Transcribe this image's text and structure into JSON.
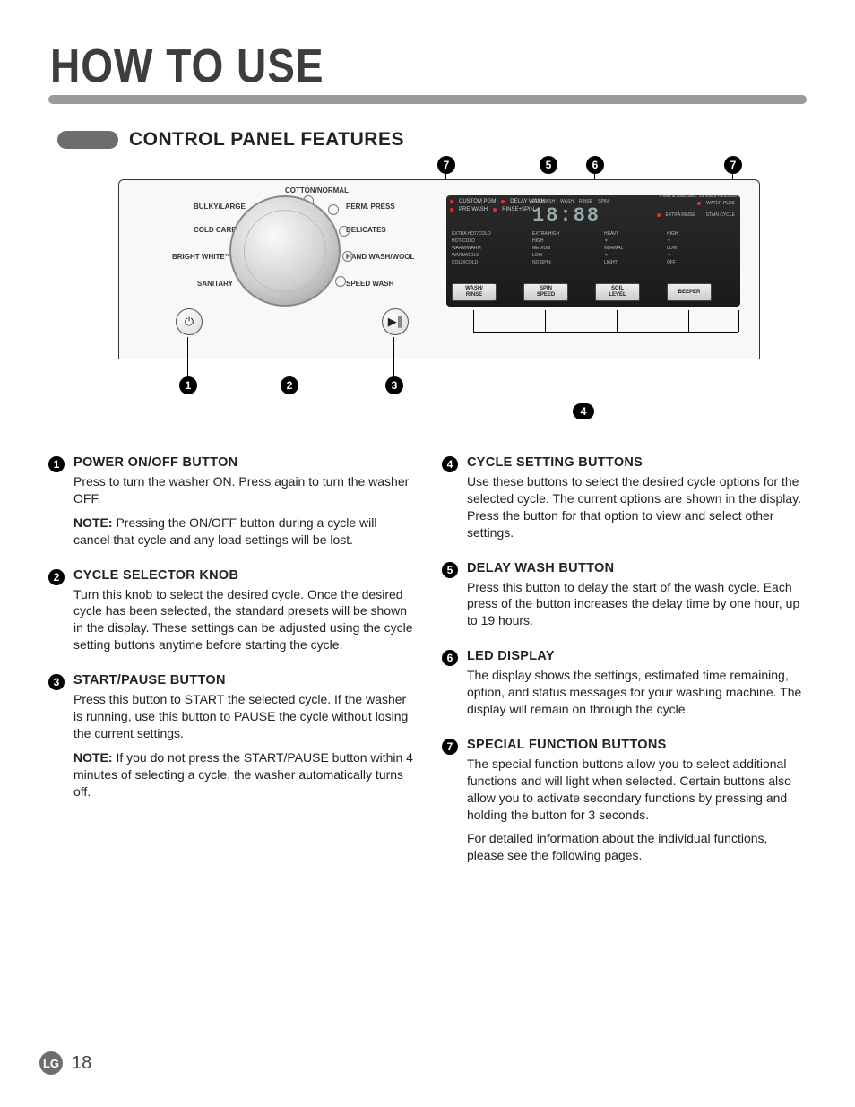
{
  "page": {
    "title": "HOW TO USE",
    "section_title": "CONTROL PANEL FEATURES",
    "page_number": "18",
    "logo_text": "LG"
  },
  "panel": {
    "cycles_left": [
      "BULKY/LARGE",
      "COLD CARE™",
      "BRIGHT WHITE™",
      "SANITARY"
    ],
    "cycle_top": "COTTON/NORMAL",
    "cycles_right": [
      "PERM. PRESS",
      "DELICATES",
      "HAND WASH/WOOL",
      "SPEED WASH"
    ],
    "top_options_left": [
      "CUSTOM PGM",
      "PRE-WASH",
      "EXTRA HOT/COLD",
      "HOT/COLD",
      "WARM/WARM",
      "WARM/COLD",
      "COLD/COLD"
    ],
    "top_options_mid": [
      "DELAY WASH",
      "RINSE+SPIN"
    ],
    "top_options_right": [
      "WATER PLUS",
      "EXTRA RINSE",
      "STAIN CYCLE"
    ],
    "digits": "18:88",
    "col_spin": [
      "EXTRA HIGH",
      "HIGH",
      "MEDIUM",
      "LOW",
      "NO SPIN"
    ],
    "col_soil": [
      "HEAVY",
      "NORMAL",
      "LIGHT"
    ],
    "col_beep": [
      "HIGH",
      "LOW",
      "OFF"
    ],
    "option_buttons": [
      "WASH/\nRINSE",
      "SPIN\nSPEED",
      "SOIL\nLEVEL",
      "BEEPER"
    ],
    "hold_note": "Press & Hold 3sec. for Extra Functions",
    "status_labels": [
      "PREWASH",
      "WASH",
      "RINSE",
      "SPIN"
    ]
  },
  "callouts": {
    "c1": "1",
    "c2": "2",
    "c3": "3",
    "c4": "4",
    "c5": "5",
    "c6": "6",
    "c7": "7"
  },
  "items": [
    {
      "num": "1",
      "title": "POWER ON/OFF BUTTON",
      "paras": [
        "Press to turn the washer ON. Press again to turn the washer OFF.",
        "<b>NOTE:</b> Pressing the ON/OFF button during a cycle will cancel that cycle and any load settings will be lost."
      ]
    },
    {
      "num": "2",
      "title": "CYCLE SELECTOR KNOB",
      "paras": [
        "Turn this knob to select the desired cycle. Once the desired cycle has been selected, the standard presets will be shown in the display. These settings can be adjusted using the cycle setting buttons anytime before starting the cycle."
      ]
    },
    {
      "num": "3",
      "title": "START/PAUSE BUTTON",
      "paras": [
        "Press this button to START the selected cycle. If the washer is running, use this button to PAUSE the cycle without losing the current settings.",
        "<b>NOTE:</b> If you do not press the START/PAUSE button within 4 minutes of selecting a cycle, the washer automatically turns off."
      ]
    },
    {
      "num": "4",
      "title": "CYCLE SETTING BUTTONS",
      "paras": [
        "Use these buttons to select the desired cycle options for the selected cycle. The current options are shown in the display. Press the button for that option to view and select other settings."
      ]
    },
    {
      "num": "5",
      "title": "DELAY WASH BUTTON",
      "paras": [
        "Press this button to delay the start of the wash cycle. Each press of the button increases the delay time by one hour, up to 19 hours."
      ]
    },
    {
      "num": "6",
      "title": "LED DISPLAY",
      "paras": [
        "The display shows the settings, estimated time remaining, option, and status messages for your washing machine. The display will remain on through the cycle."
      ]
    },
    {
      "num": "7",
      "title": "SPECIAL FUNCTION BUTTONS",
      "paras": [
        "The special function buttons allow you to select additional functions and will light when selected. Certain buttons also allow you to activate secondary functions by pressing and holding the button for 3 seconds.",
        "For detailed information about the individual functions, please see the following pages."
      ]
    }
  ]
}
